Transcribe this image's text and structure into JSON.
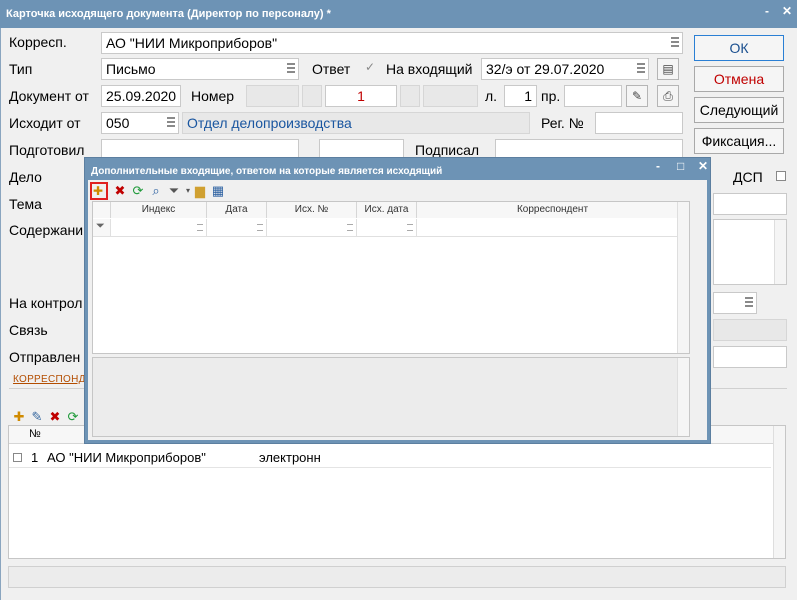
{
  "window": {
    "title": "Карточка исходящего документа (Директор по персоналу) *",
    "controls": [
      "-",
      "✕"
    ]
  },
  "form": {
    "korresp_label": "Корресп.",
    "korresp_value": "АО \"НИИ Микроприборов\"",
    "tip_label": "Тип",
    "tip_value": "Письмо",
    "otvet_label": "Ответ",
    "otvet_check": "✓",
    "na_vhod_label": "На входящий",
    "na_vhod_value": "32/э от 29.07.2020",
    "dokument_ot_label": "Документ от",
    "dokument_ot_value": "25.09.2020",
    "nomer_label": "Номер",
    "nomer_value": "1",
    "l_label": "л.",
    "l_value": "1",
    "pr_label": "пр.",
    "ishodit_label": "Исходит от",
    "ishodit_code": "050",
    "ishodit_dept": "Отдел делопроизводства",
    "reg_label": "Рег. №",
    "podgotovil_label": "Подготовил",
    "podpisal_label": "Подписал",
    "delo_label": "Дело",
    "dsp_label": "ДСП",
    "tema_label": "Тема",
    "soderzh_label": "Содержани",
    "na_kontrol_label": "На контрол",
    "svyaz_label": "Связь",
    "otpravlen_label": "Отправлен"
  },
  "buttons": {
    "ok": "ОК",
    "cancel": "Отмена",
    "next": "Следующий",
    "fix": "Фиксация..."
  },
  "modal": {
    "title": "Дополнительные входящие, ответом на которые является исходящий",
    "controls": [
      "-",
      "□",
      "✕"
    ],
    "columns": [
      "Индекс",
      "Дата",
      "Исх. №",
      "Исх. дата",
      "Корреспондент"
    ]
  },
  "bottom": {
    "tab_label": "КОРРЕСПОНДЕНТ",
    "list_header_num": "№",
    "rows": [
      {
        "num": "1",
        "name": "АО \"НИИ Микроприборов\"",
        "method": "электронн"
      }
    ]
  },
  "colors": {
    "titlebar": "#6d93b5",
    "accent": "#2a7fd4",
    "cancel": "#c00000",
    "dept_text": "#1a56a0",
    "highlight": "#e02020"
  }
}
